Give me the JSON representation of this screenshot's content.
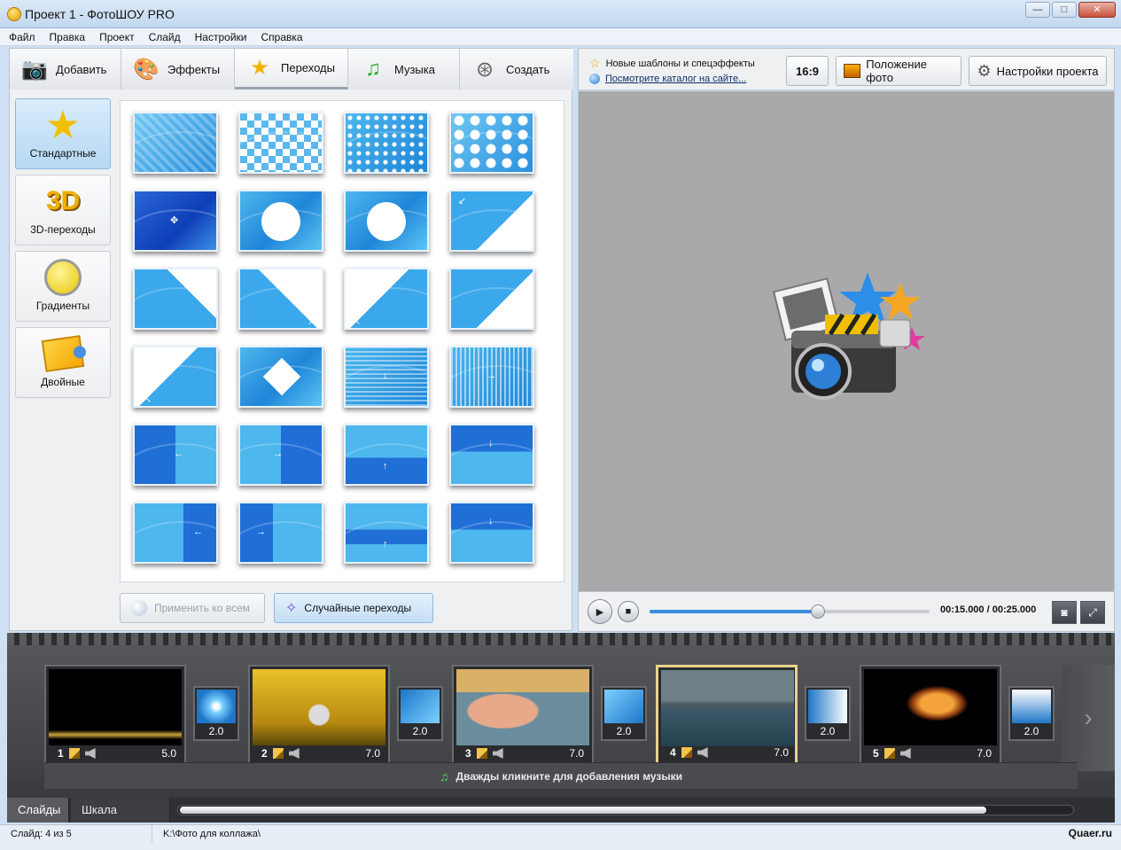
{
  "window": {
    "title": "Проект 1 - ФотоШОУ PRO",
    "controls": [
      "—",
      "□",
      "✕"
    ]
  },
  "menu": [
    "Файл",
    "Правка",
    "Проект",
    "Слайд",
    "Настройки",
    "Справка"
  ],
  "tabs": [
    {
      "label": "Добавить",
      "icon": "camera-icon"
    },
    {
      "label": "Эффекты",
      "icon": "palette-icon"
    },
    {
      "label": "Переходы",
      "icon": "star-icon",
      "active": true
    },
    {
      "label": "Музыка",
      "icon": "music-note-icon"
    },
    {
      "label": "Создать",
      "icon": "film-reel-icon"
    }
  ],
  "categories": [
    {
      "label": "Стандартные",
      "active": true
    },
    {
      "label": "3D-переходы",
      "icon_text": "3D"
    },
    {
      "label": "Градиенты"
    },
    {
      "label": "Двойные"
    }
  ],
  "transitions_grid": {
    "rows": 6,
    "cols": 4
  },
  "buttons": {
    "apply_all": "Применить ко всем",
    "random": "Случайные переходы"
  },
  "promo": {
    "line1": "Новые шаблоны и спецэффекты",
    "line2": "Посмотрите каталог на сайте..."
  },
  "right_toolbar": {
    "ratio": "16:9",
    "photo_position": "Положение фото",
    "project_settings": "Настройки проекта"
  },
  "player": {
    "timecode": "00:15.000 / 00:25.000",
    "progress": 0.6
  },
  "slides": [
    {
      "num": "1",
      "dur": "5.0"
    },
    {
      "num": "2",
      "dur": "7.0"
    },
    {
      "num": "3",
      "dur": "7.0"
    },
    {
      "num": "4",
      "dur": "7.0",
      "selected": true
    },
    {
      "num": "5",
      "dur": "7.0"
    }
  ],
  "transitions": [
    "2.0",
    "2.0",
    "2.0",
    "2.0",
    "2.0"
  ],
  "music_hint": "Дважды кликните для добавления музыки",
  "bottom_tabs": [
    "Слайды",
    "Шкала времени"
  ],
  "status": {
    "slide": "Слайд: 4 из 5",
    "path": "K:\\Фото для коллажа\\"
  },
  "watermark": "Quaer.ru",
  "colors": {
    "accent": "#3a8de0",
    "selected_slide": "#e8d28a",
    "preview_bg": "#a9a9ab"
  }
}
